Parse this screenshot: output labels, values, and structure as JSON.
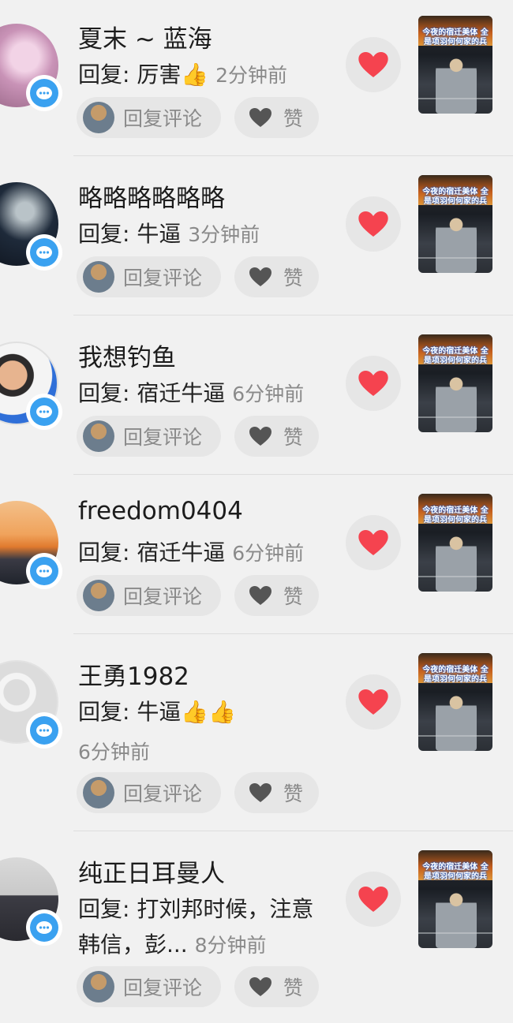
{
  "comments": [
    {
      "name": "夏末 ~ 蓝海",
      "reply_prefix": "回复: ",
      "reply_text": "厉害",
      "emoji": "👍",
      "time": "2分钟前",
      "reply_button": "回复评论",
      "like_button": "赞"
    },
    {
      "name": "略略略略略略",
      "reply_prefix": "回复: ",
      "reply_text": "牛逼",
      "time": "3分钟前",
      "reply_button": "回复评论",
      "like_button": "赞"
    },
    {
      "name": "我想钓鱼",
      "reply_prefix": "回复: ",
      "reply_text": "宿迁牛逼",
      "time": "6分钟前",
      "reply_button": "回复评论",
      "like_button": "赞"
    },
    {
      "name": "freedom0404",
      "reply_prefix": "回复: ",
      "reply_text": "宿迁牛逼",
      "time": "6分钟前",
      "reply_button": "回复评论",
      "like_button": "赞"
    },
    {
      "name": "王勇1982",
      "reply_prefix": "回复: ",
      "reply_text": "牛逼",
      "emoji": "👍👍",
      "time": "6分钟前",
      "reply_button": "回复评论",
      "like_button": "赞"
    },
    {
      "name": "纯正日耳曼人",
      "reply_prefix": "回复: ",
      "reply_text": "打刘邦时候，注意",
      "reply_text_line2": "韩信，彭...",
      "time": "8分钟前",
      "reply_button": "回复评论",
      "like_button": "赞"
    }
  ],
  "thumbnail_caption": "今夜的宿迁美体 全是项羽何何家的兵",
  "icons": {
    "badge": "comment-bubble-icon",
    "liked": "heart-filled-icon",
    "like": "heart-outline-icon"
  },
  "colors": {
    "background": "#f1f1f1",
    "accent_blue": "#3aa1f0",
    "heart_red": "#f5434f",
    "muted_text": "#8a8a8a"
  }
}
